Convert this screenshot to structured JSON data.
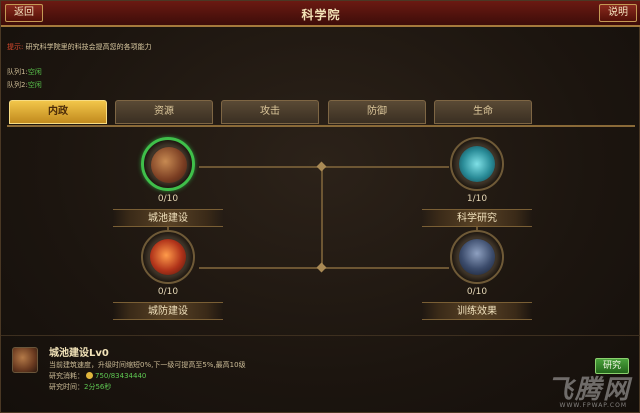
{
  "header": {
    "title": "科学院",
    "back_label": "返回",
    "help_label": "说明"
  },
  "tip": {
    "label": "提示:",
    "text": "研究科学院里的科技会提高您的各项能力"
  },
  "queues": [
    {
      "label": "队列1:",
      "status": "空闲"
    },
    {
      "label": "队列2:",
      "status": "空闲"
    }
  ],
  "tabs": [
    {
      "label": "内政",
      "active": true
    },
    {
      "label": "资源",
      "active": false
    },
    {
      "label": "攻击",
      "active": false
    },
    {
      "label": "防御",
      "active": false
    },
    {
      "label": "生命",
      "active": false
    }
  ],
  "tree": {
    "nodes": [
      {
        "name": "城池建设",
        "progress": "0/10",
        "icon": "city-building-icon",
        "highlight": true
      },
      {
        "name": "科学研究",
        "progress": "1/10",
        "icon": "science-research-icon",
        "highlight": false
      },
      {
        "name": "城防建设",
        "progress": "0/10",
        "icon": "city-defense-icon",
        "highlight": false
      },
      {
        "name": "训练效果",
        "progress": "0/10",
        "icon": "training-effect-icon",
        "highlight": false
      }
    ]
  },
  "detail": {
    "name": "城池建设Lv0",
    "desc": "当前建筑速度，升级时间缩短0%,下一级可提高至5%,最高10级",
    "cost_label": "研究消耗：",
    "cost_value": "750/83434440",
    "time_label": "研究时间：",
    "time_value": "2分56秒",
    "research_label": "研究"
  },
  "watermark": {
    "text": "飞腾网",
    "url": "WWW.FPWAP.COM"
  },
  "colors": {
    "accent": "#f2c64a",
    "highlight_ring": "#3fbf4a",
    "header": "#6b1a12"
  }
}
